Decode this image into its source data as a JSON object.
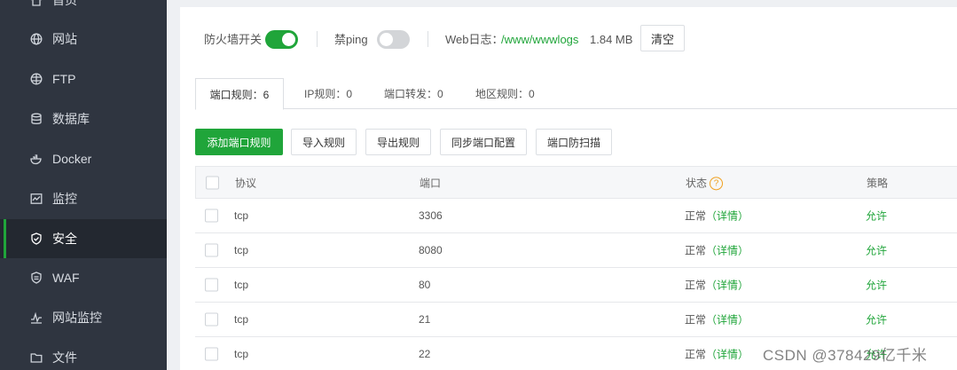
{
  "sidebar": {
    "items": [
      {
        "label": "首页",
        "icon": "home-icon"
      },
      {
        "label": "网站",
        "icon": "globe-icon"
      },
      {
        "label": "FTP",
        "icon": "ftp-globe-icon"
      },
      {
        "label": "数据库",
        "icon": "database-icon"
      },
      {
        "label": "Docker",
        "icon": "docker-icon"
      },
      {
        "label": "监控",
        "icon": "monitor-icon"
      },
      {
        "label": "安全",
        "icon": "shield-check-icon",
        "active": true
      },
      {
        "label": "WAF",
        "icon": "waf-shield-icon"
      },
      {
        "label": "网站监控",
        "icon": "pulse-icon"
      },
      {
        "label": "文件",
        "icon": "folder-icon"
      }
    ]
  },
  "topbar": {
    "firewall_label": "防火墙开关",
    "firewall_on": true,
    "ping_label": "禁ping",
    "ping_on": false,
    "weblog_label": "Web日志：",
    "weblog_path": "/www/wwwlogs",
    "weblog_size": "1.84 MB",
    "clear_button": "清空"
  },
  "tabs": [
    {
      "label": "端口规则：6",
      "active": true
    },
    {
      "label": "IP规则：0"
    },
    {
      "label": "端口转发：0"
    },
    {
      "label": "地区规则：0"
    }
  ],
  "actions": {
    "add": "添加端口规则",
    "import": "导入规则",
    "export": "导出规则",
    "sync": "同步端口配置",
    "scan": "端口防扫描"
  },
  "table": {
    "headers": {
      "protocol": "协议",
      "port": "端口",
      "status": "状态",
      "policy": "策略"
    },
    "rows": [
      {
        "protocol": "tcp",
        "port": "3306",
        "status": "正常",
        "detail": "（详情）",
        "policy": "允许"
      },
      {
        "protocol": "tcp",
        "port": "8080",
        "status": "正常",
        "detail": "（详情）",
        "policy": "允许"
      },
      {
        "protocol": "tcp",
        "port": "80",
        "status": "正常",
        "detail": "（详情）",
        "policy": "允许"
      },
      {
        "protocol": "tcp",
        "port": "21",
        "status": "正常",
        "detail": "（详情）",
        "policy": "允许"
      },
      {
        "protocol": "tcp",
        "port": "22",
        "status": "正常",
        "detail": "（详情）",
        "policy": "允许"
      }
    ]
  },
  "watermark": "CSDN @378429亿千米",
  "colors": {
    "accent": "#20a53a",
    "sidebar": "#2f3540",
    "warning": "#f0a020"
  }
}
